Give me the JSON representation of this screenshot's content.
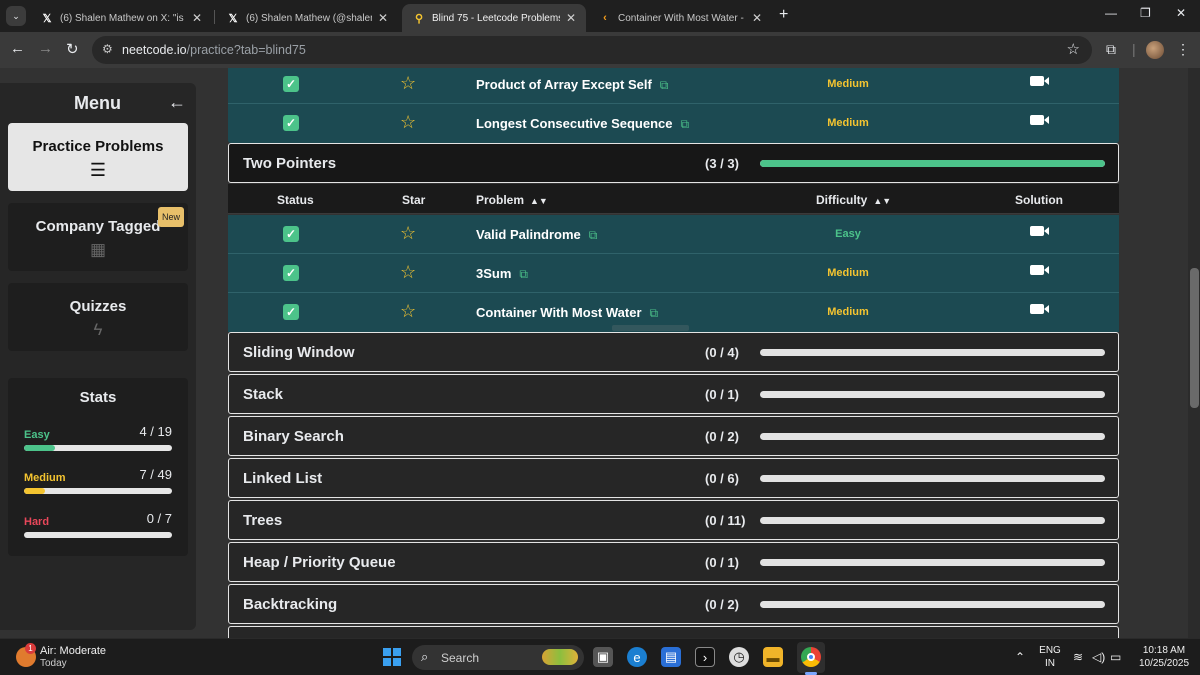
{
  "browser": {
    "tabs": [
      {
        "title": "(6) Shalen Mathew on X: \"is @n",
        "favicon": "x-logo-icon",
        "active": false
      },
      {
        "title": "(6) Shalen Mathew (@shalenma",
        "favicon": "x-logo-icon",
        "active": false
      },
      {
        "title": "Blind 75 - Leetcode Problems w",
        "favicon": "neetcode-icon",
        "active": true
      },
      {
        "title": "Container With Most Water - Le",
        "favicon": "leetcode-icon",
        "active": false
      }
    ],
    "url_host": "neetcode.io",
    "url_path": "/practice?tab=blind75"
  },
  "sidebar": {
    "title": "Menu",
    "items": [
      {
        "label": "Practice Problems",
        "icon": "list-icon",
        "active": true
      },
      {
        "label": "Company Tagged",
        "icon": "building-icon",
        "badge": "New"
      },
      {
        "label": "Quizzes",
        "icon": "lightning-icon"
      }
    ],
    "stats": {
      "title": "Stats",
      "rows": [
        {
          "name": "Easy",
          "count": "4 / 19",
          "fraction": 0.21,
          "color": "#4cc38a"
        },
        {
          "name": "Medium",
          "count": "7 / 49",
          "fraction": 0.143,
          "color": "#f4c430"
        },
        {
          "name": "Hard",
          "count": "0 / 7",
          "fraction": 0,
          "color": "#e8475a"
        }
      ]
    }
  },
  "colors": {
    "easy": "#4cc38a",
    "medium": "#f4c430",
    "hard": "#e8475a",
    "progress": "#4cc38a"
  },
  "problems_above": [
    {
      "name": "Product of Array Except Self",
      "difficulty": "Medium",
      "solved": true
    },
    {
      "name": "Longest Consecutive Sequence",
      "difficulty": "Medium",
      "solved": true
    }
  ],
  "expanded_category": {
    "name": "Two Pointers",
    "progress": "(3 / 3)",
    "fraction": 1.0,
    "headers": {
      "status": "Status",
      "star": "Star",
      "problem": "Problem",
      "difficulty": "Difficulty",
      "solution": "Solution"
    },
    "problems": [
      {
        "name": "Valid Palindrome",
        "difficulty": "Easy",
        "solved": true
      },
      {
        "name": "3Sum",
        "difficulty": "Medium",
        "solved": true
      },
      {
        "name": "Container With Most Water",
        "difficulty": "Medium",
        "solved": true
      }
    ]
  },
  "categories": [
    {
      "name": "Sliding Window",
      "progress": "(0 / 4)",
      "fraction": 0
    },
    {
      "name": "Stack",
      "progress": "(0 / 1)",
      "fraction": 0
    },
    {
      "name": "Binary Search",
      "progress": "(0 / 2)",
      "fraction": 0
    },
    {
      "name": "Linked List",
      "progress": "(0 / 6)",
      "fraction": 0
    },
    {
      "name": "Trees",
      "progress": "(0 / 11)",
      "fraction": 0
    },
    {
      "name": "Heap / Priority Queue",
      "progress": "(0 / 1)",
      "fraction": 0
    },
    {
      "name": "Backtracking",
      "progress": "(0 / 2)",
      "fraction": 0
    }
  ],
  "taskbar": {
    "weather_title": "Air: Moderate",
    "weather_sub": "Today",
    "weather_alert": "1",
    "search_label": "Search",
    "lang_top": "ENG",
    "lang_bottom": "IN",
    "time": "10:18 AM",
    "date": "10/25/2025"
  }
}
